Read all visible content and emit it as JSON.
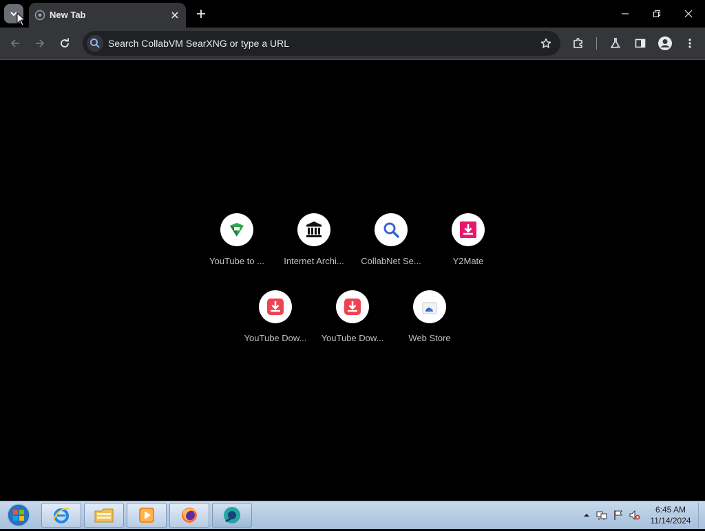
{
  "tabs": [
    {
      "title": "New Tab"
    }
  ],
  "omnibox": {
    "placeholder": "Search CollabVM SearXNG or type a URL"
  },
  "shortcuts": [
    {
      "label": "YouTube to ...",
      "icon": "youtube-to-mp3-icon"
    },
    {
      "label": "Internet Archi...",
      "icon": "internet-archive-icon"
    },
    {
      "label": "CollabNet Se...",
      "icon": "magnifier-icon"
    },
    {
      "label": "Y2Mate",
      "icon": "download-icon"
    },
    {
      "label": "YouTube Dow...",
      "icon": "download-icon"
    },
    {
      "label": "YouTube Dow...",
      "icon": "download-icon"
    },
    {
      "label": "Web Store",
      "icon": "web-store-icon"
    }
  ],
  "taskbar": {
    "apps": [
      "Internet Explorer",
      "Windows Explorer",
      "Windows Media Player",
      "Firefox",
      "Chromium"
    ],
    "clock": {
      "time": "6:45 AM",
      "date": "11/14/2024"
    }
  },
  "colors": {
    "accent": "#8ab4f8",
    "tab_bg": "#35363a",
    "page_bg": "#000000"
  }
}
